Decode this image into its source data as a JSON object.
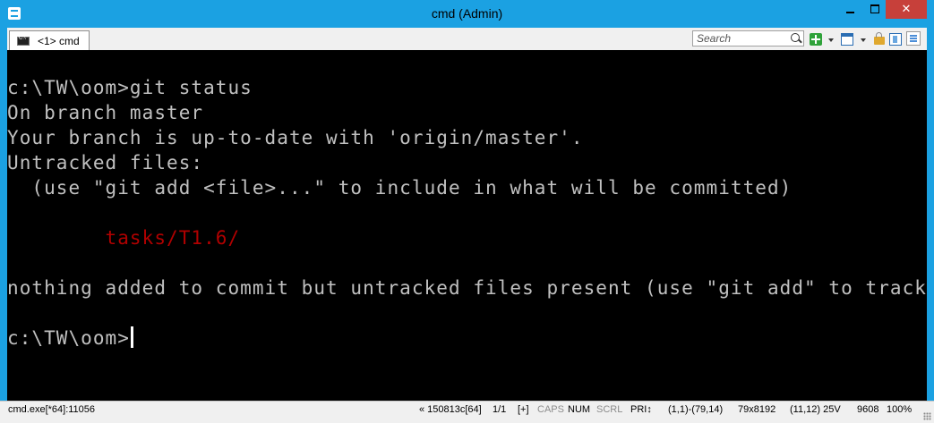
{
  "window": {
    "title": "cmd (Admin)"
  },
  "tab": {
    "label": "<1> cmd"
  },
  "search": {
    "placeholder": "Search"
  },
  "console": {
    "lines": [
      "c:\\TW\\oom>git status",
      "On branch master",
      "Your branch is up-to-date with 'origin/master'.",
      "Untracked files:",
      "  (use \"git add <file>...\" to include in what will be committed)",
      "        tasks/T1.6/",
      "nothing added to commit but untracked files present (use \"git add\" to track)",
      "c:\\TW\\oom>"
    ],
    "colors": {
      "text": "#c0c0c0",
      "untracked": "#b00000",
      "background": "#000000"
    }
  },
  "status": {
    "process": "cmd.exe[*64]:11056",
    "build": "« 150813c[64]",
    "console_index": "1/1",
    "plus": "[+]",
    "caps": "CAPS",
    "num": "NUM",
    "scrl": "SCRL",
    "pri": "PRI↕",
    "selection": "(1,1)-(79,14)",
    "buffer": "79x8192",
    "cursor": "(11,12) 25V",
    "pid": "9608",
    "zoom": "100%"
  },
  "accent_color": "#1ba1e2"
}
